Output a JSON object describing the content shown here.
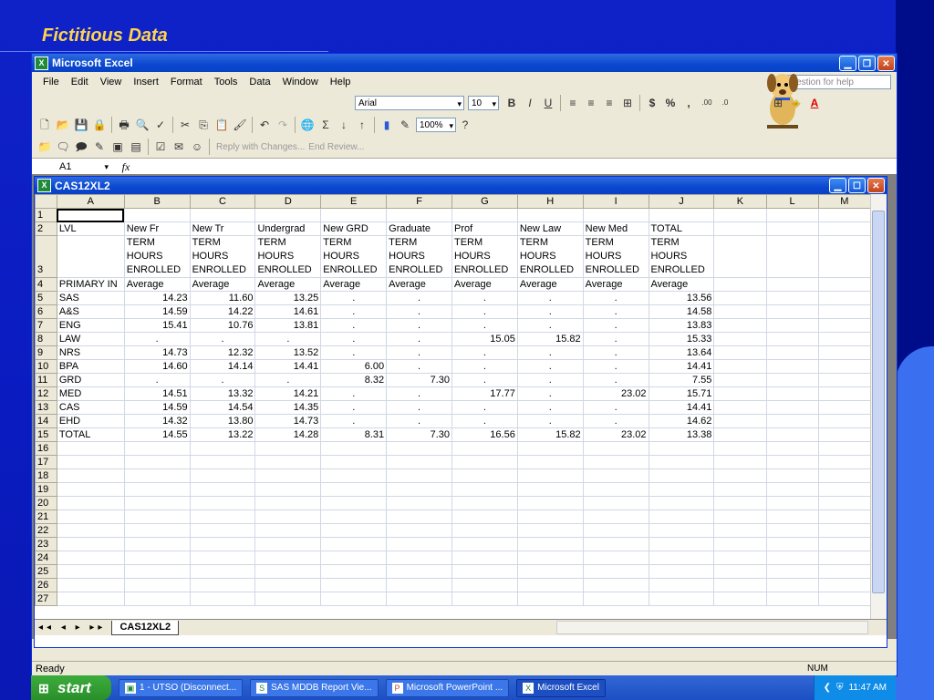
{
  "slide": {
    "title": "Fictitious Data"
  },
  "app": {
    "title": "Microsoft Excel"
  },
  "menu": [
    "File",
    "Edit",
    "View",
    "Insert",
    "Format",
    "Tools",
    "Data",
    "Window",
    "Help"
  ],
  "help": {
    "placeholder": "question for help"
  },
  "format": {
    "font": "Arial",
    "size": "10"
  },
  "standard": {
    "zoom": "100%"
  },
  "reviewing": {
    "reply": "Reply with Changes...",
    "end": "End Review..."
  },
  "formula": {
    "namebox": "A1",
    "fx": "fx"
  },
  "workbook": {
    "title": "CAS12XL2",
    "sheet_tab": "CAS12XL2"
  },
  "grid": {
    "columns": [
      "A",
      "B",
      "C",
      "D",
      "E",
      "F",
      "G",
      "H",
      "I",
      "J",
      "K",
      "L",
      "M"
    ],
    "row_numbers": [
      "1",
      "2",
      "3",
      "4",
      "5",
      "6",
      "7",
      "8",
      "9",
      "10",
      "11",
      "12",
      "13",
      "14",
      "15",
      "16",
      "17",
      "18",
      "19",
      "20",
      "21",
      "22",
      "23",
      "24",
      "25",
      "26",
      "27"
    ],
    "rows": [
      [
        "",
        "",
        "",
        "",
        "",
        "",
        "",
        "",
        "",
        "",
        "",
        "",
        ""
      ],
      [
        "LVL",
        "New Fr",
        "New Tr",
        "Undergrad",
        "New GRD",
        "Graduate",
        "Prof",
        "New Law",
        "New Med",
        "TOTAL",
        "",
        "",
        ""
      ],
      [
        "",
        "TERM HOURS ENROLLED",
        "TERM HOURS ENROLLED",
        "TERM HOURS ENROLLED",
        "TERM HOURS ENROLLED",
        "TERM HOURS ENROLLED",
        "TERM HOURS ENROLLED",
        "TERM HOURS ENROLLED",
        "TERM HOURS ENROLLED",
        "TERM HOURS ENROLLED",
        "",
        "",
        ""
      ],
      [
        "PRIMARY IN",
        "Average",
        "Average",
        "Average",
        "Average",
        "Average",
        "Average",
        "Average",
        "Average",
        "Average",
        "",
        "",
        ""
      ],
      [
        "SAS",
        "14.23",
        "11.60",
        "13.25",
        ".",
        ".",
        ".",
        ".",
        ".",
        "13.56",
        "",
        "",
        ""
      ],
      [
        "A&S",
        "14.59",
        "14.22",
        "14.61",
        ".",
        ".",
        ".",
        ".",
        ".",
        "14.58",
        "",
        "",
        ""
      ],
      [
        "ENG",
        "15.41",
        "10.76",
        "13.81",
        ".",
        ".",
        ".",
        ".",
        ".",
        "13.83",
        "",
        "",
        ""
      ],
      [
        "LAW",
        ".",
        ".",
        ".",
        ".",
        ".",
        "15.05",
        "15.82",
        ".",
        "15.33",
        "",
        "",
        ""
      ],
      [
        "NRS",
        "14.73",
        "12.32",
        "13.52",
        ".",
        ".",
        ".",
        ".",
        ".",
        "13.64",
        "",
        "",
        ""
      ],
      [
        "BPA",
        "14.60",
        "14.14",
        "14.41",
        "6.00",
        ".",
        ".",
        ".",
        ".",
        "14.41",
        "",
        "",
        ""
      ],
      [
        "GRD",
        ".",
        ".",
        ".",
        "8.32",
        "7.30",
        ".",
        ".",
        ".",
        "7.55",
        "",
        "",
        ""
      ],
      [
        "MED",
        "14.51",
        "13.32",
        "14.21",
        ".",
        ".",
        "17.77",
        ".",
        "23.02",
        "15.71",
        "",
        "",
        ""
      ],
      [
        "CAS",
        "14.59",
        "14.54",
        "14.35",
        ".",
        ".",
        ".",
        ".",
        ".",
        "14.41",
        "",
        "",
        ""
      ],
      [
        "EHD",
        "14.32",
        "13.80",
        "14.73",
        ".",
        ".",
        ".",
        ".",
        ".",
        "14.62",
        "",
        "",
        ""
      ],
      [
        "TOTAL",
        "14.55",
        "13.22",
        "14.28",
        "8.31",
        "7.30",
        "16.56",
        "15.82",
        "23.02",
        "13.38",
        "",
        "",
        ""
      ]
    ]
  },
  "status": {
    "left": "Ready",
    "num": "NUM"
  },
  "taskbar": {
    "start": "start",
    "tasks": [
      "1 - UTSO (Disconnect...",
      "SAS MDDB Report Vie...",
      "Microsoft PowerPoint ...",
      "Microsoft Excel"
    ],
    "clock": "11:47 AM"
  }
}
